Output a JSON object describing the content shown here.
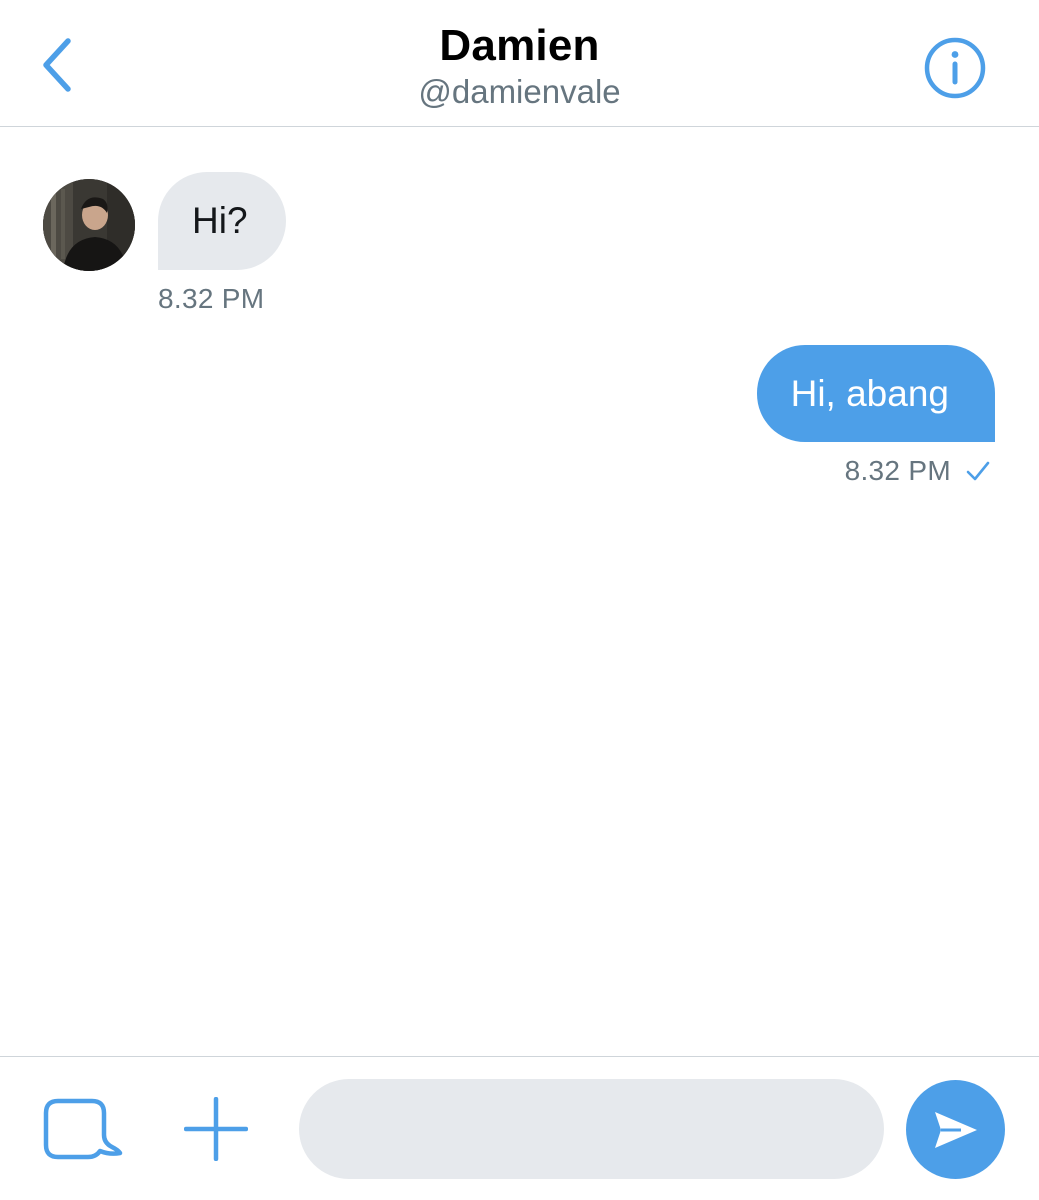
{
  "header": {
    "name": "Damien",
    "handle": "@damienvale",
    "back_icon": "chevron-left-icon",
    "info_icon": "info-circle-icon"
  },
  "messages": [
    {
      "direction": "incoming",
      "text": "Hi?",
      "time": "8.32 PM"
    },
    {
      "direction": "outgoing",
      "text": "Hi, abang",
      "time": "8.32 PM",
      "status_icon": "checkmark-icon"
    }
  ],
  "composer": {
    "placeholder": "",
    "value": "",
    "gif_icon": "gif-media-icon",
    "add_icon": "plus-icon",
    "send_icon": "send-arrow-icon"
  },
  "colors": {
    "accent": "#4d9fe8",
    "incoming_bubble": "#e6e9ed",
    "secondary_text": "#66757f",
    "divider": "#cfd5da"
  }
}
